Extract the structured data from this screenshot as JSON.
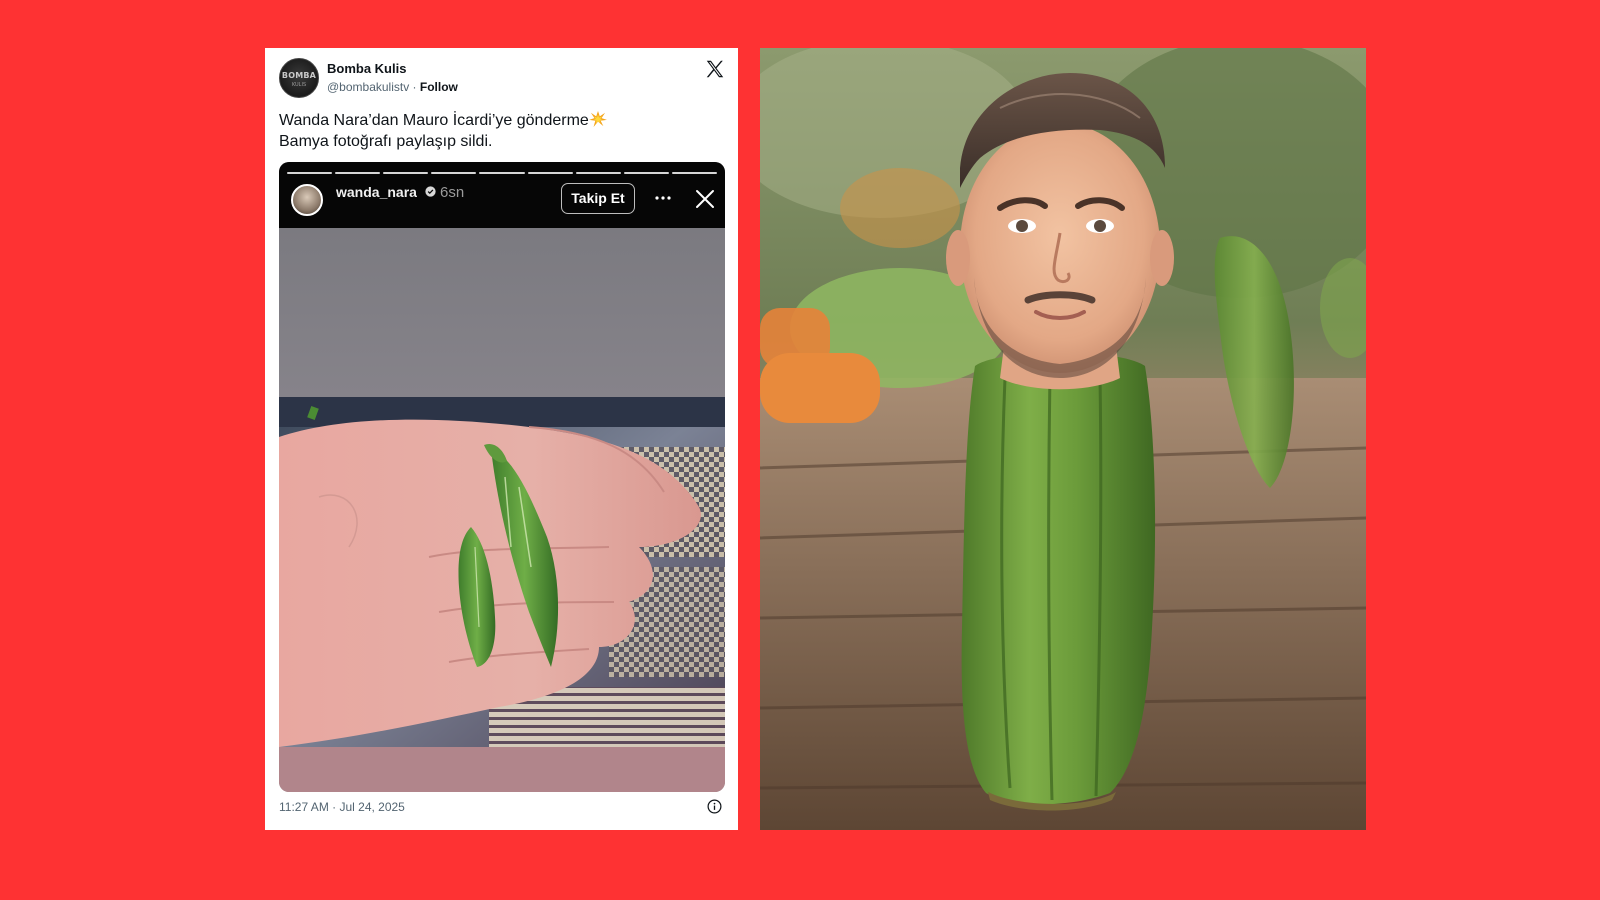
{
  "page": {
    "background_color": "#fe3233"
  },
  "tweet": {
    "display_name": "Bomba Kulis",
    "handle": "@bombakulistv",
    "separator": " · ",
    "follow_label": "Follow",
    "avatar_text": "BOMBA",
    "avatar_subtext": "KULIS",
    "text_line1": "Wanda Nara’dan Mauro İcardi’ye gönderme",
    "text_line2": "Bamya fotoğrafı paylaşıp sildi.",
    "timestamp": "11:27 AM · Jul 24, 2025",
    "icons": {
      "brand": "x-logo-icon",
      "emoji": "collision-emoji-icon",
      "info": "info-icon"
    }
  },
  "story": {
    "username": "wanda_nara",
    "time": "6sn",
    "follow_button": "Takip Et",
    "progress_segments": 9,
    "icons": {
      "verified": "verified-badge-icon",
      "more": "more-options-icon",
      "close": "close-icon"
    },
    "colors": {
      "header": "#060606",
      "top_fill": "#7d7b81",
      "bottom_fill": "#b1858b"
    }
  },
  "images": {
    "story_photo": "hand holding two green okra pods",
    "meme_photo": "man's face on top of an okra pod on a wooden table"
  }
}
